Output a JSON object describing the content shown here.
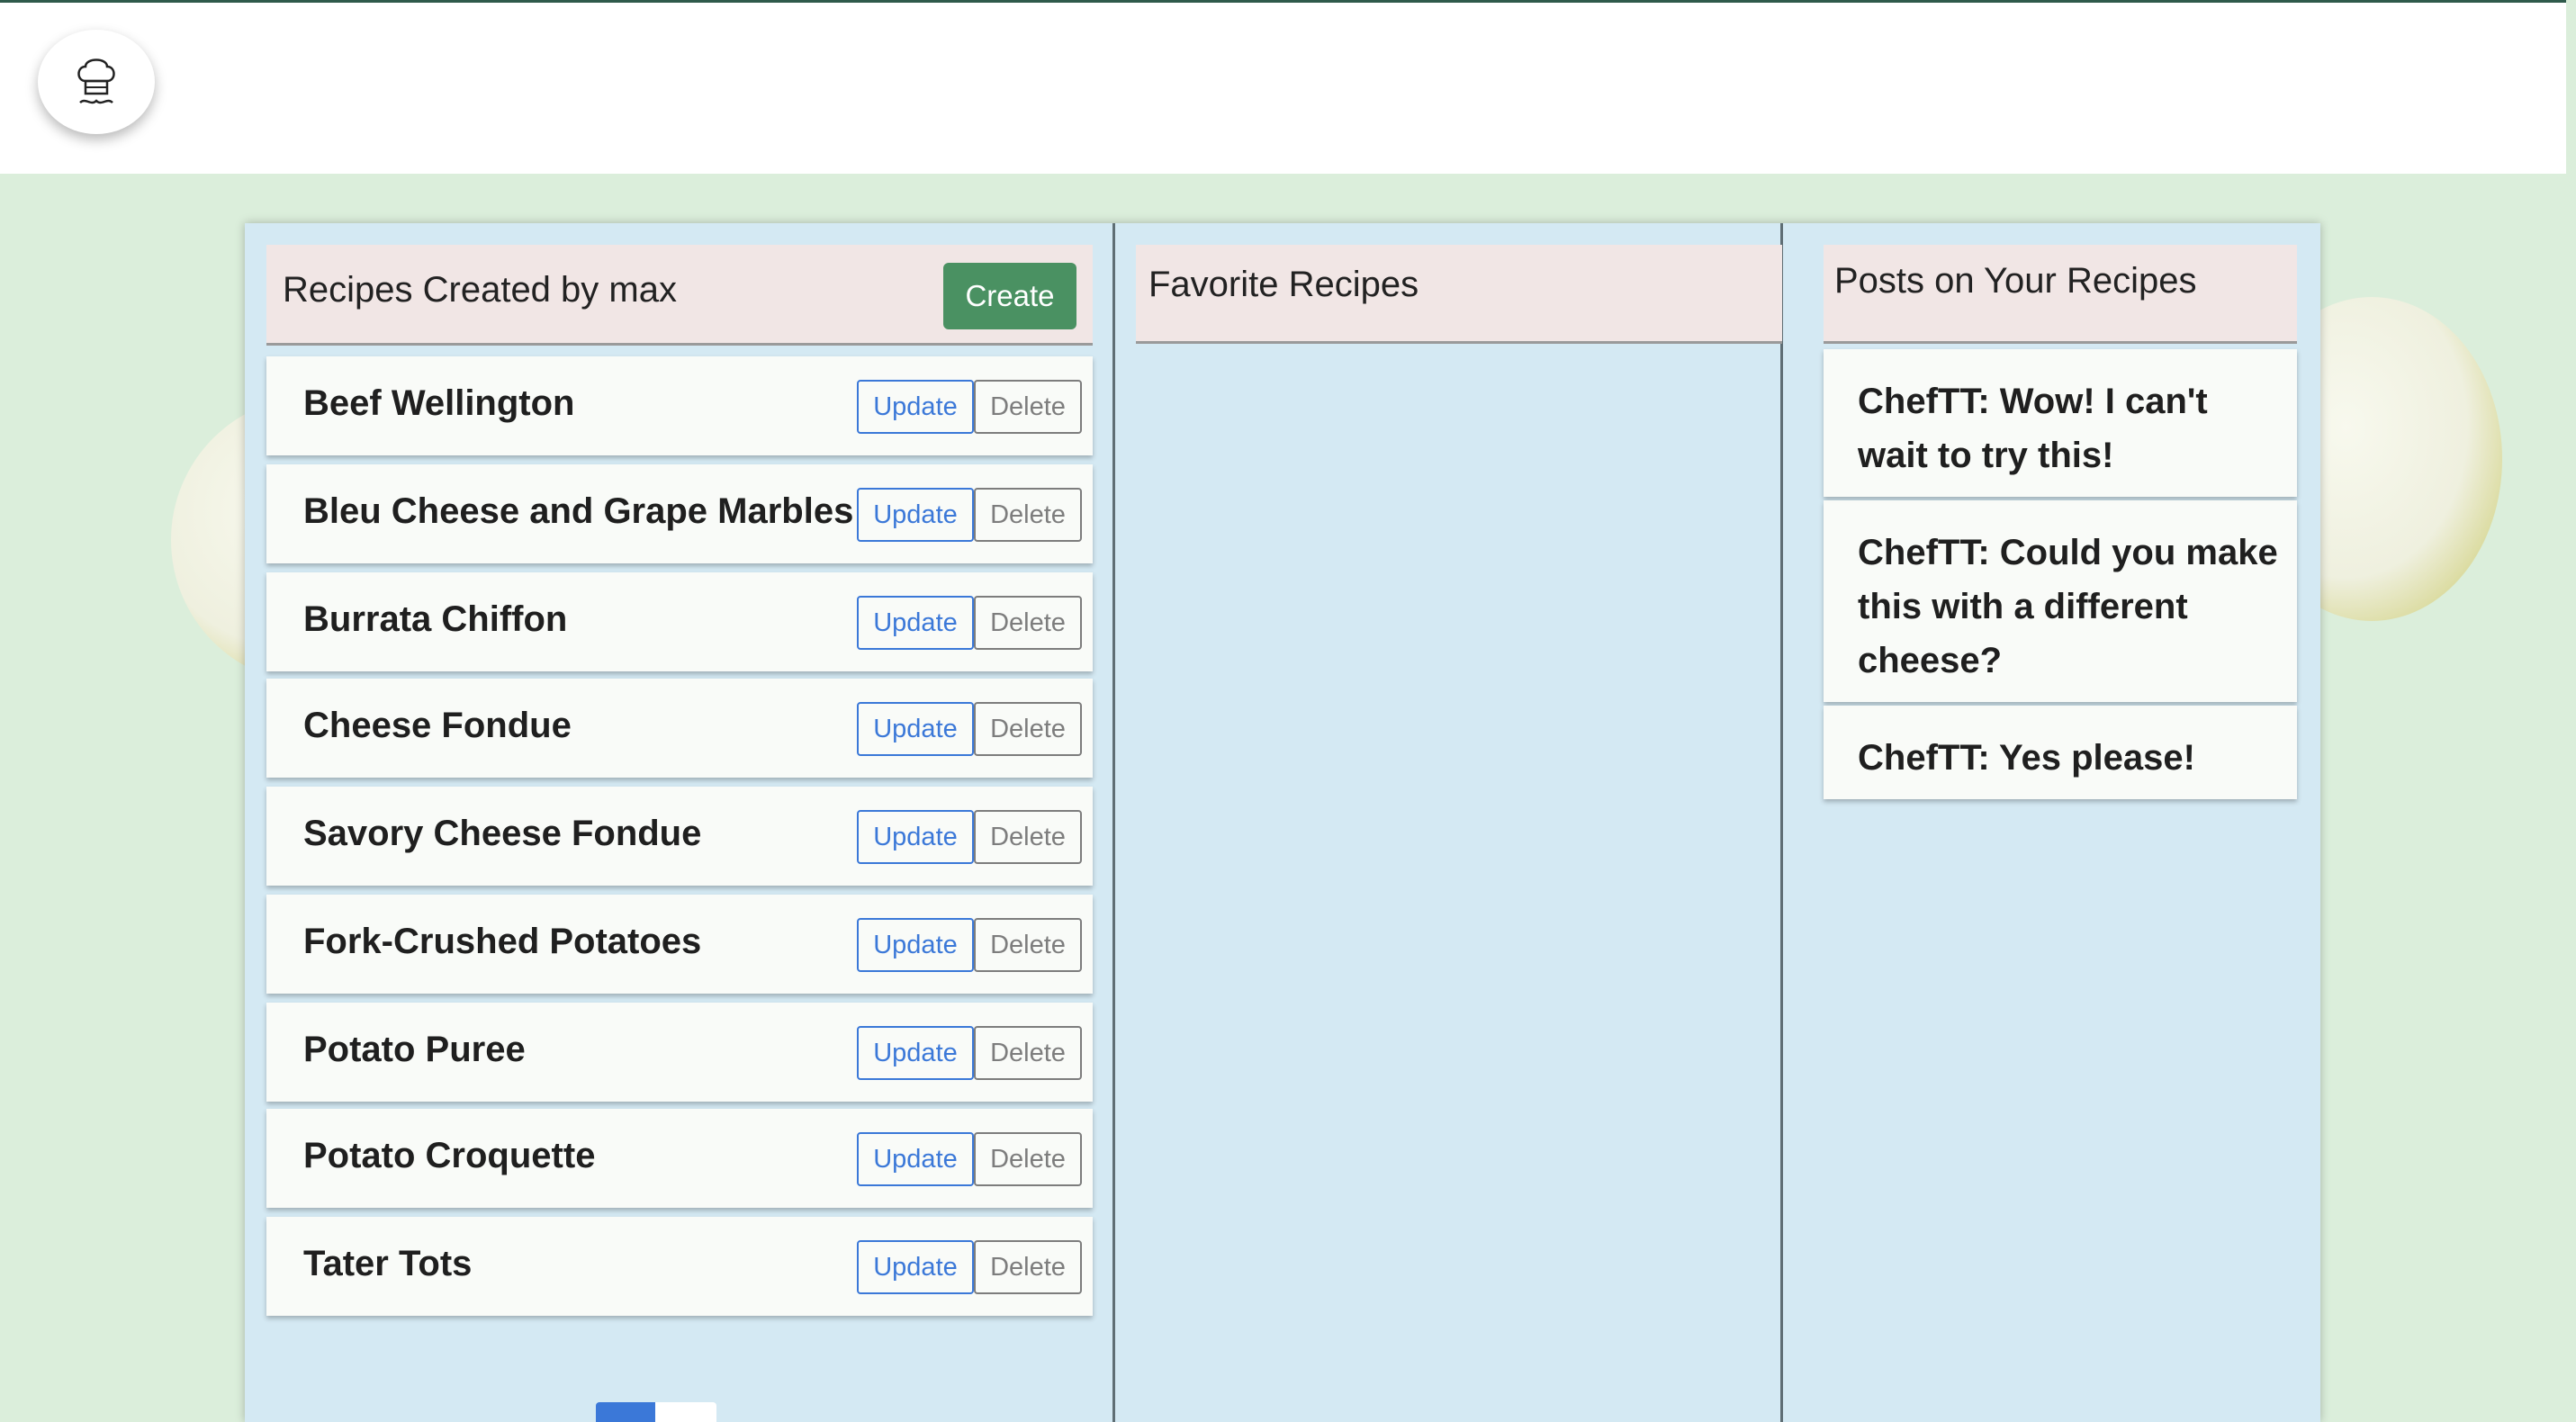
{
  "app": {
    "logo_icon": "chef-hat-icon"
  },
  "my_recipes": {
    "title": "Recipes Created by max",
    "create_label": "Create",
    "update_label": "Update",
    "delete_label": "Delete",
    "items": [
      "Beef Wellington",
      "Bleu Cheese and Grape Marbles",
      "Burrata Chiffon",
      "Cheese Fondue",
      "Savory Cheese Fondue",
      "Fork-Crushed Potatoes",
      "Potato Puree",
      "Potato Croquette",
      "Tater Tots"
    ]
  },
  "favorites": {
    "title": "Favorite Recipes"
  },
  "posts": {
    "title": "Posts on Your Recipes",
    "items": [
      "ChefTT: Wow! I can't wait to try this!",
      "ChefTT: Could you make this with a different cheese?",
      "ChefTT: Yes please!"
    ]
  },
  "colors": {
    "accent_blue": "#3b78d8",
    "create_green": "#4a9162",
    "background_green": "#dbeedb",
    "panel_blue": "#d4e9f3",
    "header_pink": "#f1e6e5"
  }
}
